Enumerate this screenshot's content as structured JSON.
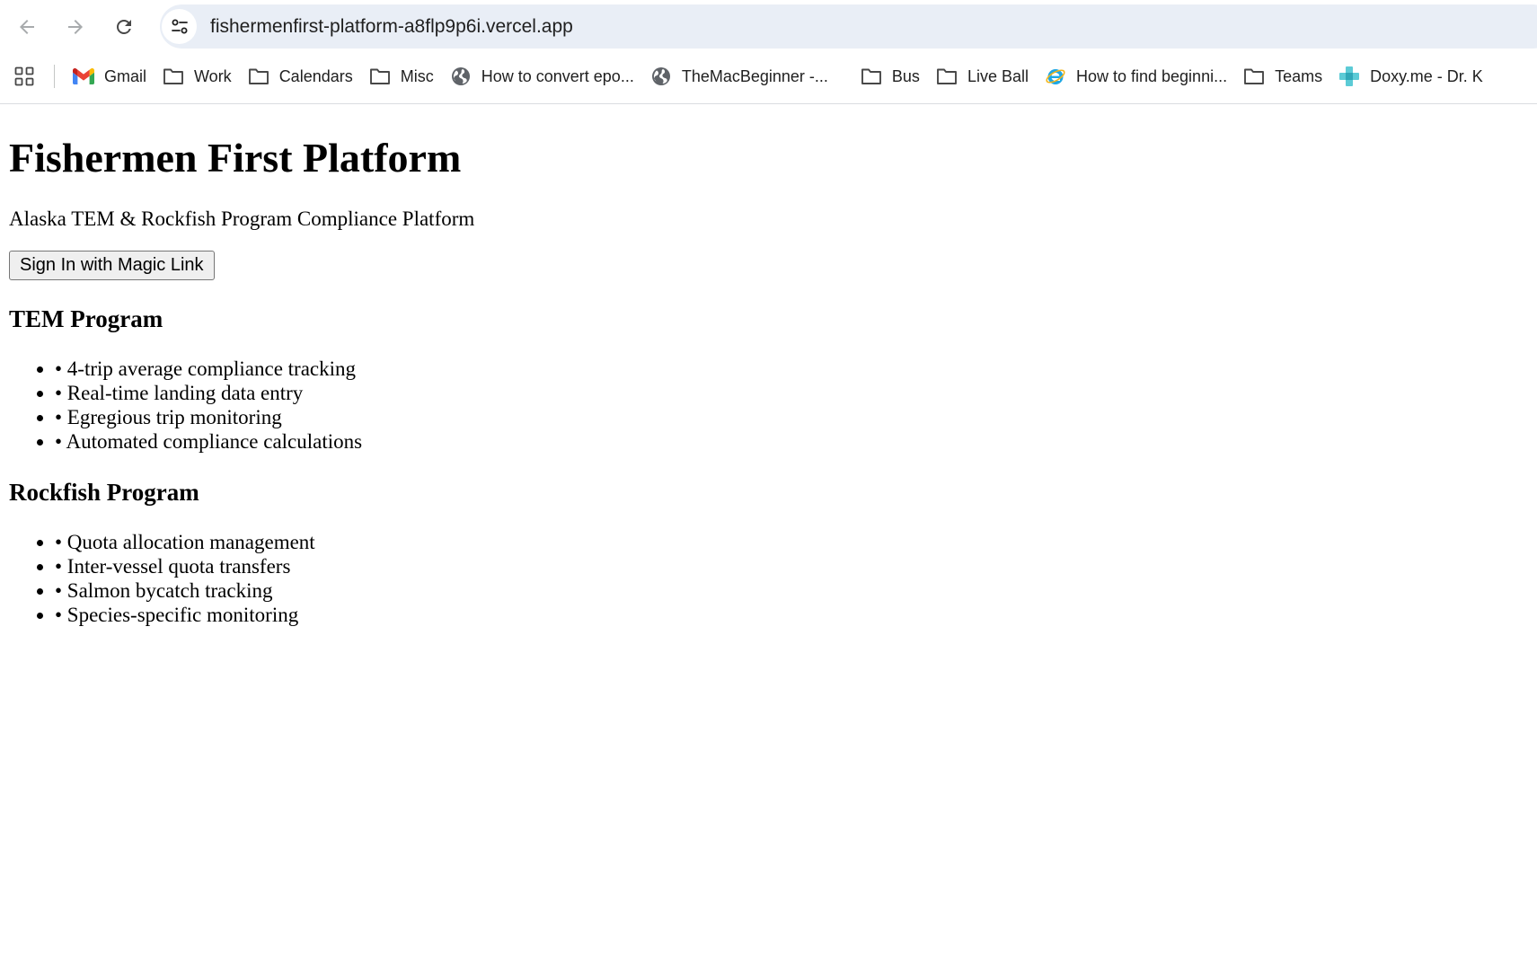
{
  "browser": {
    "url": "fishermenfirst-platform-a8flp9p6i.vercel.app",
    "bookmarks": [
      {
        "label": "Gmail",
        "icon": "gmail-icon"
      },
      {
        "label": "Work",
        "icon": "folder-icon"
      },
      {
        "label": "Calendars",
        "icon": "folder-icon"
      },
      {
        "label": "Misc",
        "icon": "folder-icon"
      },
      {
        "label": "How to convert epo...",
        "icon": "globe-icon"
      },
      {
        "label": "TheMacBeginner -...",
        "icon": "globe-icon"
      },
      {
        "label": "Bus",
        "icon": "folder-icon"
      },
      {
        "label": "Live Ball",
        "icon": "folder-icon"
      },
      {
        "label": "How to find beginni...",
        "icon": "ie-icon"
      },
      {
        "label": "Teams",
        "icon": "folder-icon"
      },
      {
        "label": "Doxy.me - Dr. K",
        "icon": "doxy-icon"
      }
    ]
  },
  "page": {
    "title": "Fishermen First Platform",
    "subtitle": "Alaska TEM & Rockfish Program Compliance Platform",
    "signin_label": "Sign In with Magic Link",
    "sections": [
      {
        "heading": "TEM Program",
        "items": [
          "• 4-trip average compliance tracking",
          "• Real-time landing data entry",
          "• Egregious trip monitoring",
          "• Automated compliance calculations"
        ]
      },
      {
        "heading": "Rockfish Program",
        "items": [
          "• Quota allocation management",
          "• Inter-vessel quota transfers",
          "• Salmon bycatch tracking",
          "• Species-specific monitoring"
        ]
      }
    ]
  }
}
